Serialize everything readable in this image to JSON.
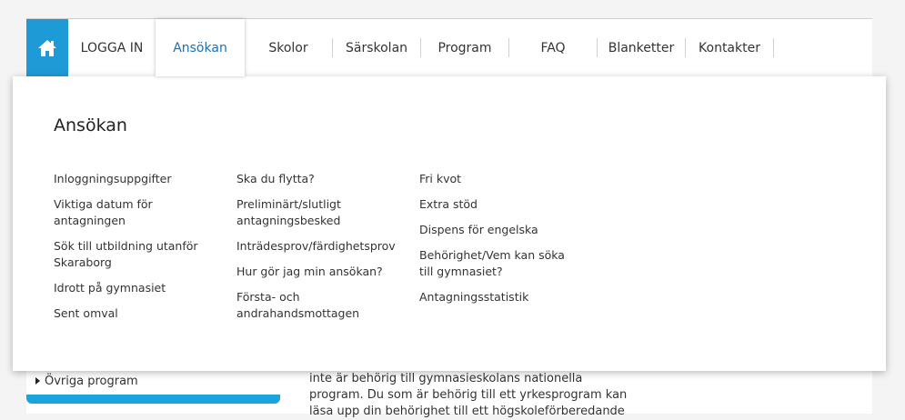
{
  "nav": {
    "home_icon": "home-icon",
    "items": [
      {
        "label": "LOGGA IN"
      },
      {
        "label": "Ansökan"
      },
      {
        "label": "Skolor"
      },
      {
        "label": "Särskolan"
      },
      {
        "label": "Program"
      },
      {
        "label": "FAQ"
      },
      {
        "label": "Blanketter"
      },
      {
        "label": "Kontakter"
      }
    ],
    "active_color": "#1e6fb0",
    "home_bg": "#1e9ad6"
  },
  "mega_menu": {
    "title": "Ansökan",
    "columns": [
      {
        "links": [
          "Inloggningsuppgifter",
          "Viktiga datum för antagningen",
          "Sök till utbildning utanför Skaraborg",
          "Idrott på gymnasiet",
          "Sent omval"
        ]
      },
      {
        "links": [
          "Ska du flytta?",
          "Preliminärt/slutligt antagningsbesked",
          "Inträdesprov/färdighetsprov",
          "Hur gör jag min ansökan?",
          "Första- och andrahandsmottagen"
        ]
      },
      {
        "links": [
          "Fri kvot",
          "Extra stöd",
          "Dispens för engelska",
          "Behörighet/Vem kan söka till gymnasiet?",
          "Antagningsstatistik"
        ]
      }
    ]
  },
  "sidebar": {
    "items": [
      {
        "label": "Övriga program"
      }
    ],
    "accent": "#1aa3de"
  },
  "content": {
    "lines": [
      "inte är behörig till gymnasieskolans nationella",
      "program. Du som är behörig till ett yrkesprogram kan",
      "läsa upp din behörighet till ett högskoleförberedande"
    ]
  }
}
